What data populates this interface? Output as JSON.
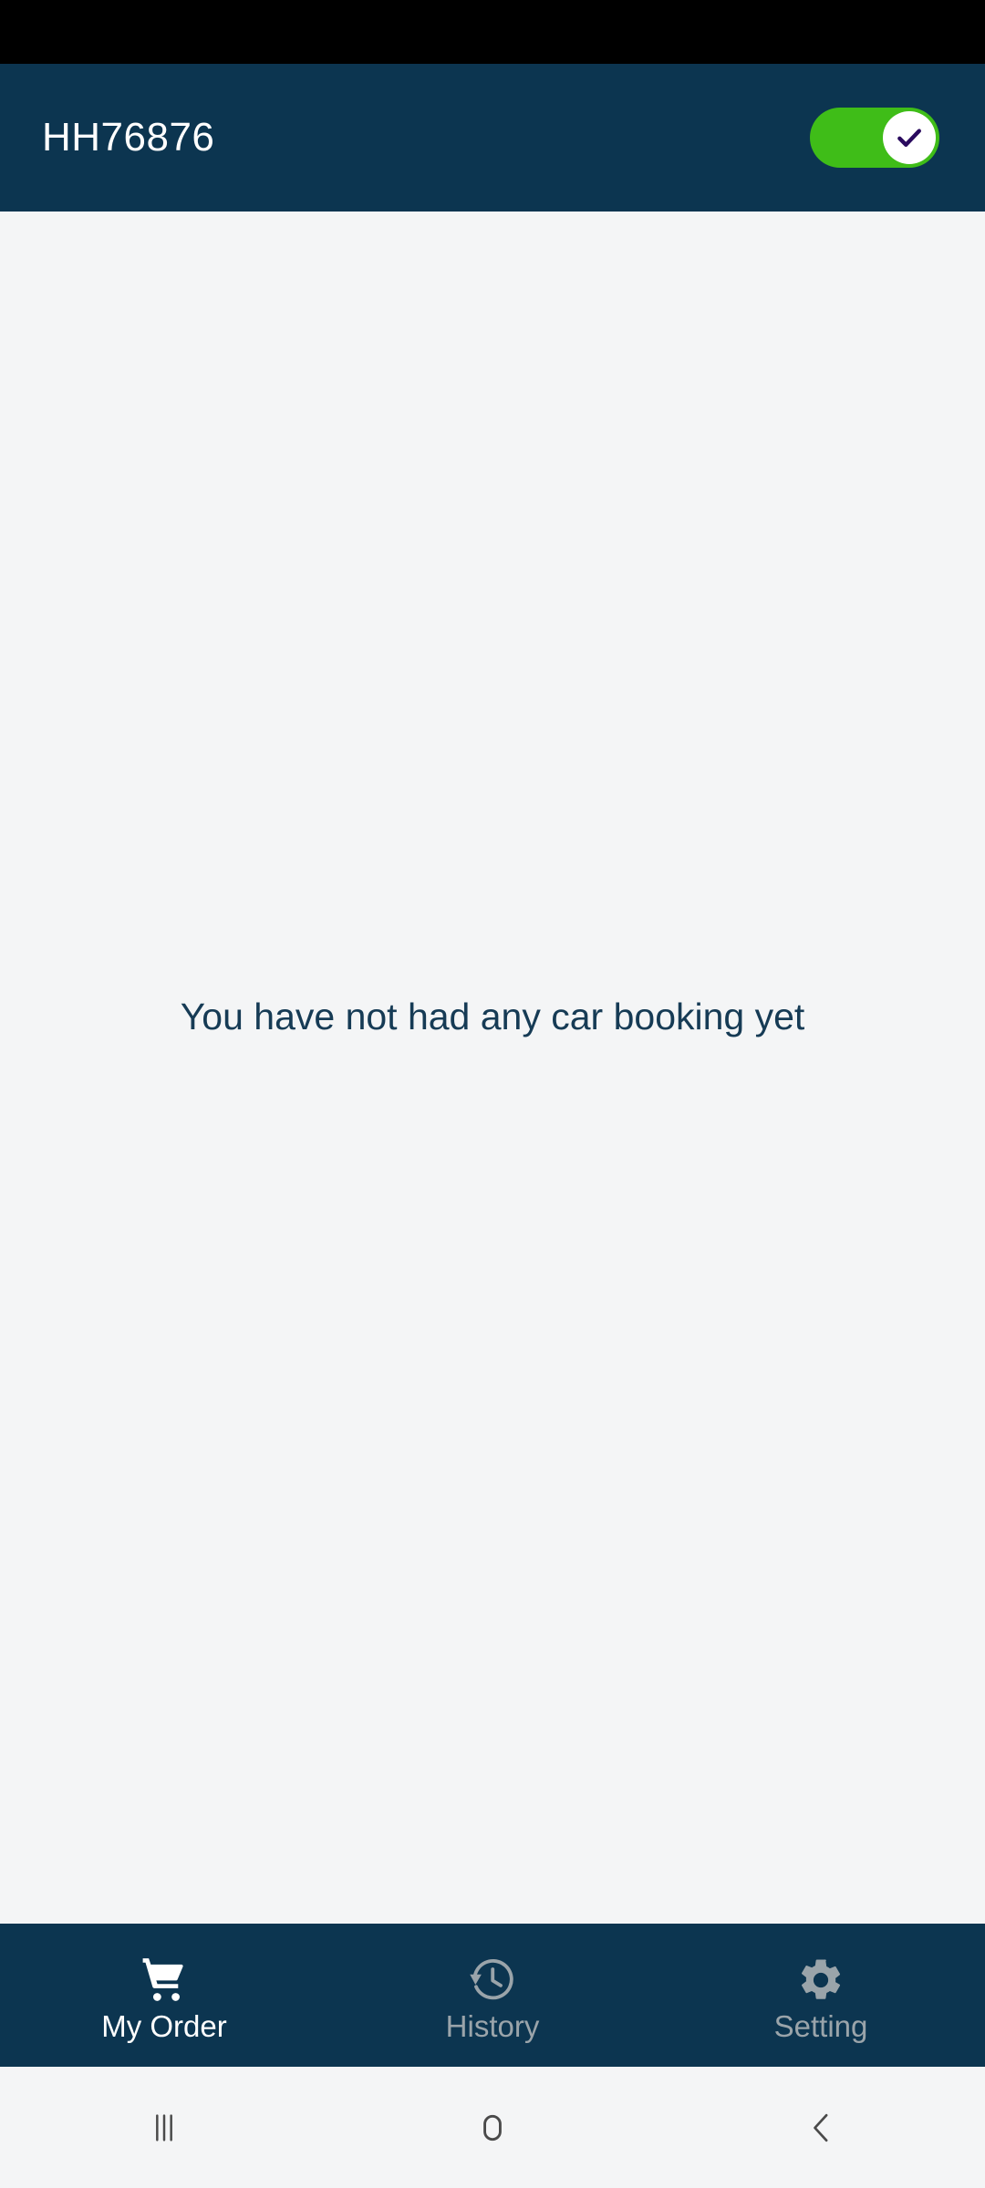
{
  "status_bar": {
    "background": "#000000",
    "content": ""
  },
  "header": {
    "title": "HH76876",
    "background": "#0C3550",
    "title_color": "#FFFFFF",
    "toggle": {
      "name": "availability-toggle",
      "state": "on",
      "track_color": "#3FBD18",
      "knob_color": "#FFFFFF",
      "check_color": "#2A0A5E",
      "icon": "check-icon"
    }
  },
  "main": {
    "background": "#F4F5F6",
    "empty_message": "You have not had any car booking yet",
    "empty_message_color": "#163B55"
  },
  "tab_bar": {
    "background": "#0C3550",
    "active_color": "#FFFFFF",
    "inactive_color": "#9AA4AA",
    "tabs": [
      {
        "label": "My Order",
        "icon": "shopping-cart-icon",
        "active": true
      },
      {
        "label": "History",
        "icon": "history-clock-icon",
        "active": false
      },
      {
        "label": "Setting",
        "icon": "gear-icon",
        "active": false
      }
    ]
  },
  "system_nav": {
    "background": "#F4F5F6",
    "icon_color": "#4A4A4A",
    "buttons": [
      {
        "name": "recent-apps-button",
        "icon": "recent-apps-icon"
      },
      {
        "name": "home-button",
        "icon": "home-icon"
      },
      {
        "name": "back-button",
        "icon": "chevron-left-icon"
      }
    ]
  }
}
